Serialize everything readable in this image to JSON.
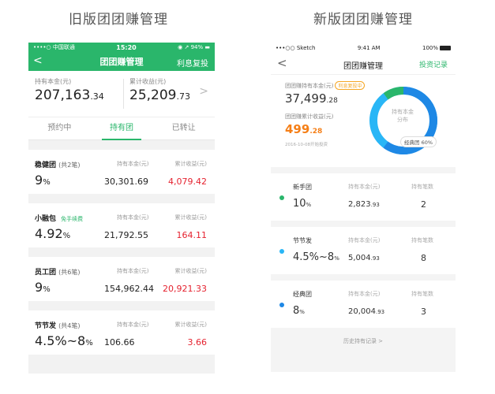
{
  "labels": {
    "old_title": "旧版团团赚管理",
    "new_title": "新版团团赚管理"
  },
  "old": {
    "status": {
      "carrier": "••••○ 中国联通 ",
      "time": "15:20",
      "battery": "◉ ↗ 94% ▬"
    },
    "nav": {
      "back": "<",
      "title": "团团赚管理",
      "right": "利息复投"
    },
    "summary": {
      "principal_label": "持有本金(元)",
      "principal_int": "207,163",
      "principal_dec": ".34",
      "income_label": "累计收益(元)",
      "income_int": "25,209",
      "income_dec": ".73"
    },
    "tabs": [
      "预约中",
      "持有团",
      "已转让"
    ],
    "active_tab": 1,
    "cards": [
      {
        "name": "稳健团",
        "sub": "(共2笔)",
        "tag": "",
        "h1": "持有本金(元)",
        "h2": "累计收益(元)",
        "rate": "9",
        "rate_unit": "%",
        "principal": "30,301.69",
        "income": "4,079.42"
      },
      {
        "name": "小融包",
        "sub": "",
        "tag": "免手续费",
        "h1": "持有本金(元)",
        "h2": "累计收益(元)",
        "rate": "4.92",
        "rate_unit": "%",
        "principal": "21,792.55",
        "income": "164.11"
      },
      {
        "name": "员工团",
        "sub": "(共6笔)",
        "tag": "",
        "h1": "持有本金(元)",
        "h2": "累计收益(元)",
        "rate": "9",
        "rate_unit": "%",
        "principal": "154,962.44",
        "income": "20,921.33"
      },
      {
        "name": "节节发",
        "sub": "(共4笔)",
        "tag": "",
        "h1": "持有本金(元)",
        "h2": "累计收益(元)",
        "rate": "4.5%~8",
        "rate_unit": "%",
        "principal": "106.66",
        "income": "3.66"
      }
    ]
  },
  "new": {
    "status": {
      "carrier": "•••○○ Sketch ",
      "time": "9:41 AM",
      "battery": "100%"
    },
    "nav": {
      "back": "<",
      "title": "团团赚管理",
      "right": "投资记录"
    },
    "summary": {
      "principal_label": "团团赚持有本金(元)",
      "badge": "利息复投中",
      "principal_int": "37,499",
      "principal_dec": ".28",
      "income_label": "团团赚累计收益(元)",
      "income_int": "499",
      "income_dec": ".28",
      "date_note": "2016-10-08开始投资",
      "donut_label_1": "持有本金",
      "donut_label_2": "分布",
      "donut_pill": "经典团 60%",
      "donut_share": 0.6,
      "colors": {
        "primary": "#1e88e5",
        "secondary": "#29b6f6",
        "tertiary": "#2ab66b"
      }
    },
    "cards": [
      {
        "name": "新手团",
        "h1": "持有本金(元)",
        "h2": "持有笔数",
        "rate": "10",
        "rate_unit": "%",
        "principal_int": "2,823",
        "principal_dec": ".93",
        "count": "2",
        "dot": "#2ab66b"
      },
      {
        "name": "节节发",
        "h1": "持有本金(元)",
        "h2": "持有笔数",
        "rate": "4.5%~8",
        "rate_unit": "%",
        "principal_int": "5,004",
        "principal_dec": ".93",
        "count": "8",
        "dot": "#29b6f6"
      },
      {
        "name": "经典团",
        "h1": "持有本金(元)",
        "h2": "持有笔数",
        "rate": "8",
        "rate_unit": "%",
        "principal_int": "20,004",
        "principal_dec": ".93",
        "count": "3",
        "dot": "#1e88e5"
      }
    ],
    "history": "历史持有记录 >"
  }
}
